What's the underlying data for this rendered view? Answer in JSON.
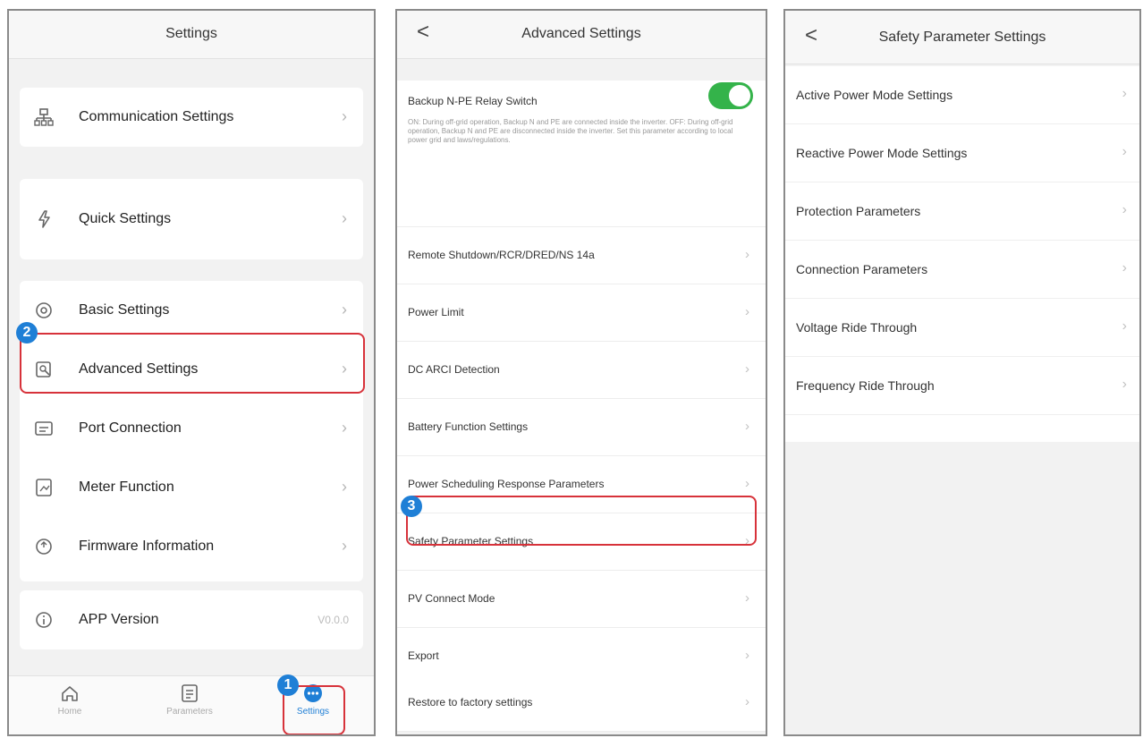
{
  "panel1": {
    "title": "Settings",
    "items": [
      {
        "label": "Communication Settings"
      },
      {
        "label": "Quick Settings"
      },
      {
        "label": "Basic Settings"
      },
      {
        "label": "Advanced Settings"
      },
      {
        "label": "Port Connection"
      },
      {
        "label": "Meter Function"
      },
      {
        "label": "Firmware Information"
      },
      {
        "label": "APP Version",
        "value": "V0.0.0"
      }
    ],
    "tabs": [
      {
        "label": "Home"
      },
      {
        "label": "Parameters"
      },
      {
        "label": "Settings"
      }
    ],
    "badges": [
      "1",
      "2"
    ]
  },
  "panel2": {
    "back": "<",
    "title": "Advanced Settings",
    "relay_title": "Backup N-PE Relay Switch",
    "relay_desc": "ON: During off-grid operation, Backup N and PE are connected inside the inverter. OFF: During off-grid operation, Backup N and PE are disconnected inside the inverter. Set this parameter according to local power grid and laws/regulations.",
    "items": [
      "Remote Shutdown/RCR/DRED/NS 14a",
      "Power Limit",
      "DC ARCI Detection",
      "Battery Function Settings",
      "Power Scheduling Response Parameters",
      "Safety Parameter Settings",
      "PV Connect Mode",
      "Export",
      "Restore to factory settings"
    ],
    "badge": "3"
  },
  "panel3": {
    "back": "<",
    "title": "Safety Parameter Settings",
    "items": [
      "Active Power Mode Settings",
      "Reactive Power Mode Settings",
      "Protection Parameters",
      "Connection Parameters",
      "Voltage Ride Through",
      "Frequency Ride Through"
    ]
  },
  "colors": {
    "highlight": "#d7323a",
    "badge": "#1f7fd6",
    "toggle_on": "#34b34a"
  }
}
